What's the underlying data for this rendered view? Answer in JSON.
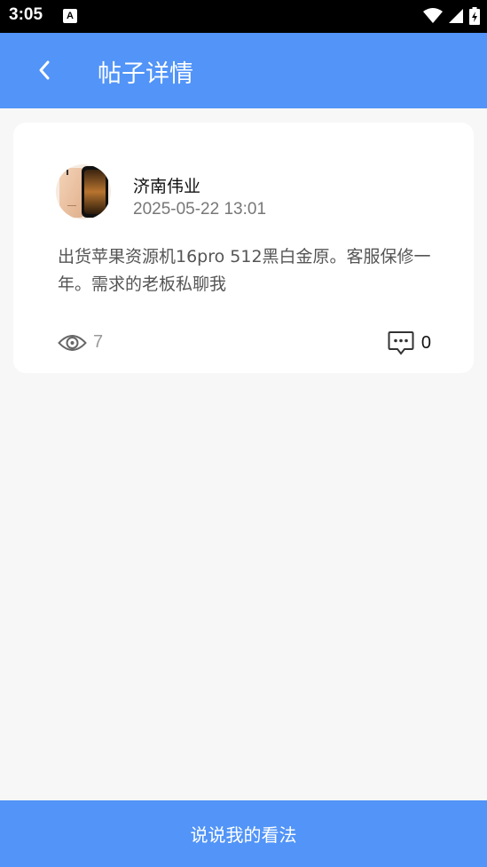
{
  "status_bar": {
    "time": "3:05",
    "notification_icon_letter": "A",
    "icons": [
      "wifi-icon",
      "signal-icon",
      "battery-charging-icon"
    ]
  },
  "header": {
    "title": "帖子详情",
    "back_icon": "back-arrow-icon",
    "background": "#5294f7"
  },
  "post": {
    "author": "济南伟业",
    "timestamp": "2025-05-22 13:01",
    "content": "出货苹果资源机16pro 512黑白金原。客服保修一年。需求的老板私聊我",
    "views": "7",
    "comments": "0",
    "view_icon": "eye-icon",
    "comment_icon": "comment-icon"
  },
  "footer": {
    "button_label": "说说我的看法"
  }
}
